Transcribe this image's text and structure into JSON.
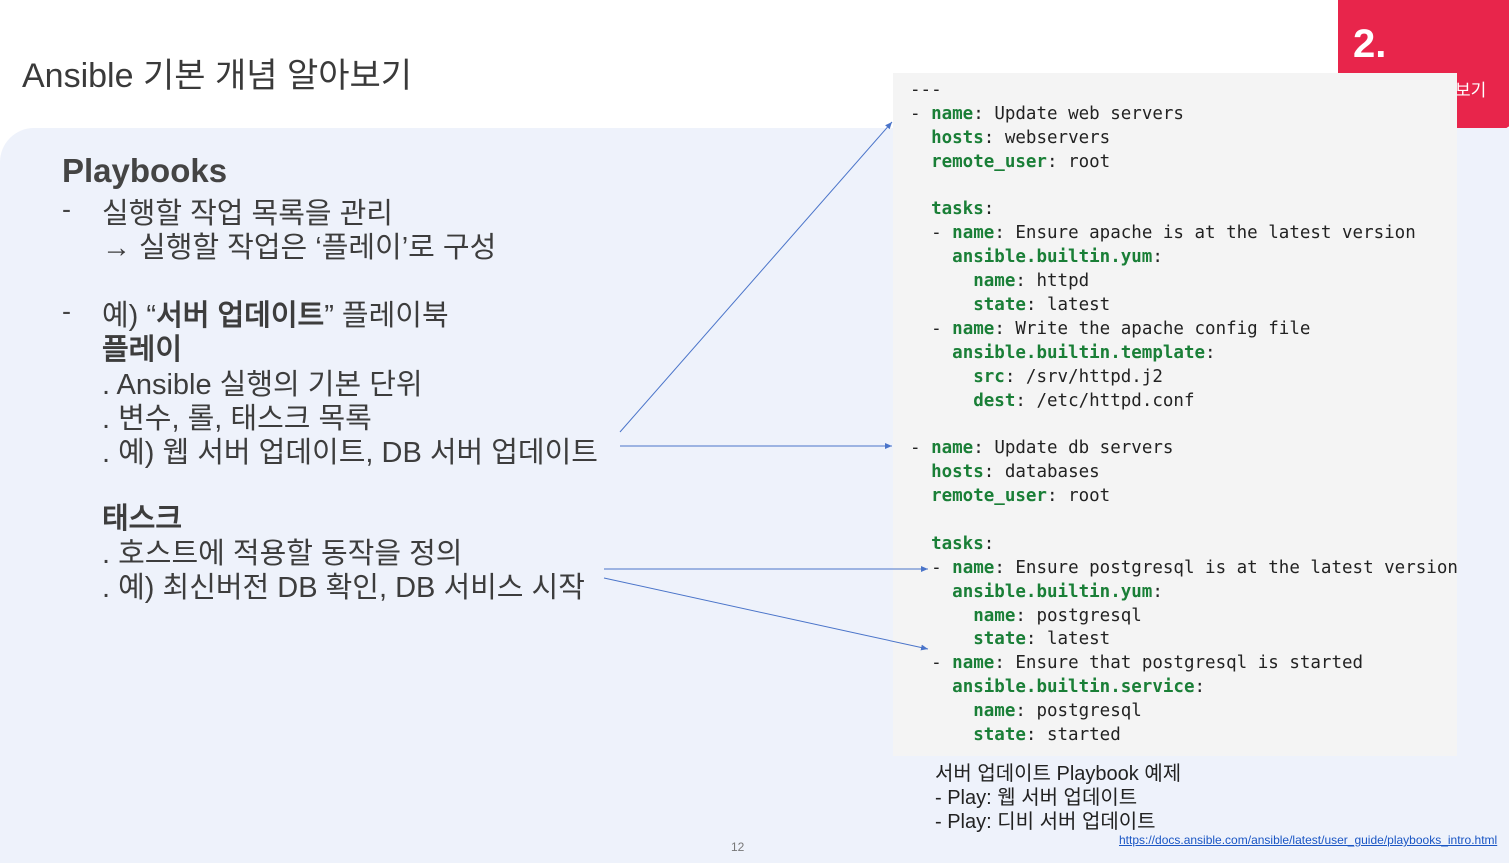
{
  "header": {
    "title": "Ansible 기본 개념 알아보기",
    "section_number": "2.",
    "section_sub": "보기"
  },
  "left": {
    "playbooks_title": "Playbooks",
    "bullet1_dash": "-",
    "bullet1_line1": "실행할 작업 목록을 관리",
    "bullet1_line2": "→ 실행할 작업은 ‘플레이’로 구성",
    "bullet2_dash": "-",
    "bullet2_prefix": "예) “",
    "bullet2_bold": "서버 업데이트",
    "bullet2_suffix": "” 플레이북",
    "play_head": "플레이",
    "play_lines": [
      ". Ansible 실행의 기본 단위",
      ". 변수, 롤, 태스크 목록",
      ". 예) 웹 서버 업데이트, DB 서버 업데이트"
    ],
    "task_head": "태스크",
    "task_lines": [
      ". 호스트에 적용할 동작을 정의",
      ". 예) 최신버전 DB 확인, DB 서비스 시작"
    ]
  },
  "code": {
    "lines": [
      {
        "indent": "",
        "key": "",
        "text": "---"
      },
      {
        "indent": "- ",
        "key": "name",
        "text": " Update web servers"
      },
      {
        "indent": "  ",
        "key": "hosts",
        "text": " webservers"
      },
      {
        "indent": "  ",
        "key": "remote_user",
        "text": " root"
      },
      {
        "indent": "",
        "key": "",
        "text": ""
      },
      {
        "indent": "  ",
        "key": "tasks",
        "text": ""
      },
      {
        "indent": "  - ",
        "key": "name",
        "text": " Ensure apache is at the latest version"
      },
      {
        "indent": "    ",
        "key": "ansible.builtin.yum",
        "text": ""
      },
      {
        "indent": "      ",
        "key": "name",
        "text": " httpd"
      },
      {
        "indent": "      ",
        "key": "state",
        "text": " latest"
      },
      {
        "indent": "  - ",
        "key": "name",
        "text": " Write the apache config file"
      },
      {
        "indent": "    ",
        "key": "ansible.builtin.template",
        "text": ""
      },
      {
        "indent": "      ",
        "key": "src",
        "text": " /srv/httpd.j2"
      },
      {
        "indent": "      ",
        "key": "dest",
        "text": " /etc/httpd.conf"
      },
      {
        "indent": "",
        "key": "",
        "text": ""
      },
      {
        "indent": "- ",
        "key": "name",
        "text": " Update db servers"
      },
      {
        "indent": "  ",
        "key": "hosts",
        "text": " databases"
      },
      {
        "indent": "  ",
        "key": "remote_user",
        "text": " root"
      },
      {
        "indent": "",
        "key": "",
        "text": ""
      },
      {
        "indent": "  ",
        "key": "tasks",
        "text": ""
      },
      {
        "indent": "  - ",
        "key": "name",
        "text": " Ensure postgresql is at the latest version"
      },
      {
        "indent": "    ",
        "key": "ansible.builtin.yum",
        "text": ""
      },
      {
        "indent": "      ",
        "key": "name",
        "text": " postgresql"
      },
      {
        "indent": "      ",
        "key": "state",
        "text": " latest"
      },
      {
        "indent": "  - ",
        "key": "name",
        "text": " Ensure that postgresql is started"
      },
      {
        "indent": "    ",
        "key": "ansible.builtin.service",
        "text": ""
      },
      {
        "indent": "      ",
        "key": "name",
        "text": " postgresql"
      },
      {
        "indent": "      ",
        "key": "state",
        "text": " started"
      }
    ]
  },
  "caption": {
    "line1": "서버 업데이트 Playbook 예제",
    "line2": "-   Play: 웹 서버 업데이트",
    "line3": "-   Play: 디비 서버 업데이트"
  },
  "link_text": "https://docs.ansible.com/ansible/latest/user_guide/playbooks_intro.html",
  "page_number": "12",
  "colors": {
    "accent": "#e8254b",
    "panel": "#eef2fb",
    "yaml_key": "#1a7f37",
    "arrow": "#4a74c9"
  }
}
